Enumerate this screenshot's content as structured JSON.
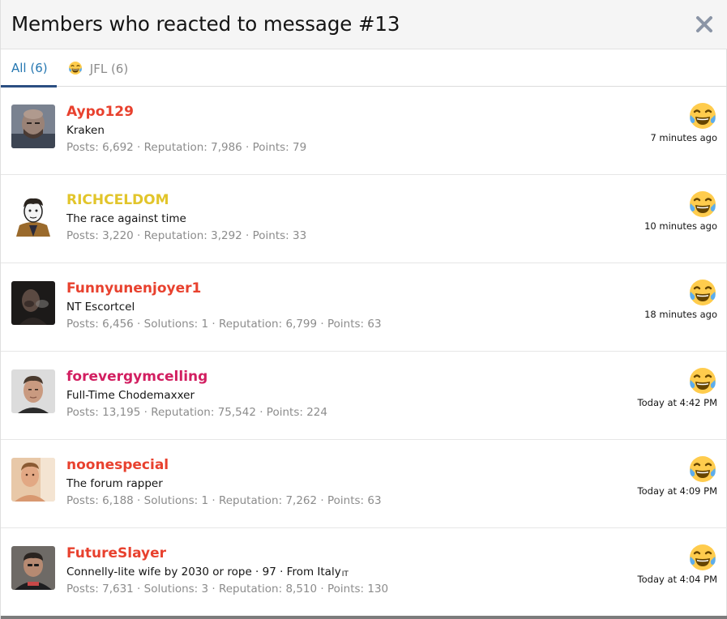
{
  "dialog": {
    "title": "Members who reacted to message #13",
    "close_icon": "close-icon"
  },
  "tabs": [
    {
      "label": "All (6)",
      "active": true
    },
    {
      "label": "JFL (6)",
      "icon": "joy-cry-emoji-icon",
      "active": false
    }
  ],
  "members": [
    {
      "username": "Aypo129",
      "color": "#e8412e",
      "title": "Kraken",
      "stats": "Posts: 6,692 · Reputation: 7,986 · Points: 79",
      "time": "7 minutes ago",
      "avatar_icon": "avatar-bald-man"
    },
    {
      "username": "RICHCELDOM",
      "color": "#e2c52b",
      "title": "The race against time",
      "stats": "Posts: 3,220 · Reputation: 3,292 · Points: 33",
      "time": "10 minutes ago",
      "avatar_icon": "avatar-cartoon-wojak"
    },
    {
      "username": "Funnyunenjoyer1",
      "color": "#e8412e",
      "title": "NT Escortcel",
      "stats": "Posts: 6,456 · Solutions: 1 · Reputation: 6,799 · Points: 63",
      "time": "18 minutes ago",
      "avatar_icon": "avatar-dark-smoker"
    },
    {
      "username": "forevergymcelling",
      "color": "#d21f61",
      "title": "Full-Time Chodemaxxer",
      "stats": "Posts: 13,195 · Reputation: 75,542 · Points: 224",
      "time": "Today at 4:42 PM",
      "avatar_icon": "avatar-man-portrait"
    },
    {
      "username": "noonespecial",
      "color": "#e8412e",
      "title": "The forum rapper",
      "stats": "Posts: 6,188 · Solutions: 1 · Reputation: 7,262 · Points: 63",
      "time": "Today at 4:09 PM",
      "avatar_icon": "avatar-warm-portrait"
    },
    {
      "username": "FutureSlayer",
      "color": "#e8412e",
      "title": "Connelly-lite wife by 2030 or rope · 97 · From Italy",
      "flag": "IT",
      "stats": "Posts: 7,631 · Solutions: 3 · Reputation: 8,510 · Points: 130",
      "time": "Today at 4:04 PM",
      "avatar_icon": "avatar-hooded-man"
    }
  ],
  "reaction_icon": "joy-cry-emoji-icon"
}
